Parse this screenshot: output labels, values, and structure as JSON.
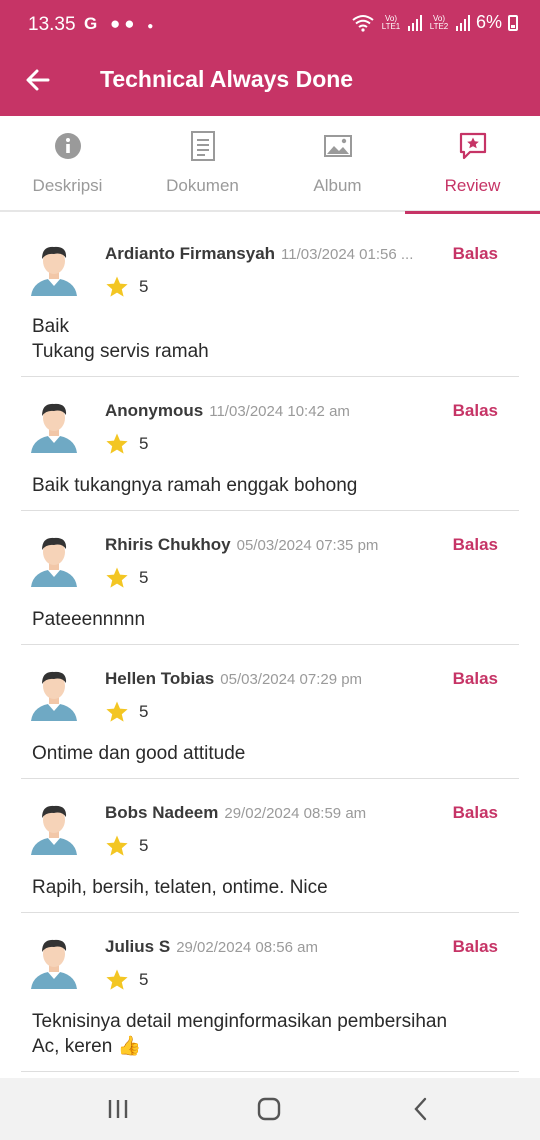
{
  "status_bar": {
    "time": "13.35",
    "notification_icons": "G",
    "battery": "6%",
    "sim1_label": "Vo) LTE1",
    "sim2_label": "Vo) LTE2"
  },
  "app_bar": {
    "title": "Technical Always Done",
    "back_icon": "arrow-left-icon"
  },
  "tabs": [
    {
      "label": "Deskripsi",
      "icon": "info-icon",
      "active": false
    },
    {
      "label": "Dokumen",
      "icon": "document-icon",
      "active": false
    },
    {
      "label": "Album",
      "icon": "image-icon",
      "active": false
    },
    {
      "label": "Review",
      "icon": "review-star-icon",
      "active": true
    }
  ],
  "reply_label": "Balas",
  "reviews": [
    {
      "name": "Ardianto Firmansyah",
      "date": "11/03/2024 01:56 ...",
      "rating": "5",
      "text": "Baik\nTukang servis ramah"
    },
    {
      "name": "Anonymous",
      "date": "11/03/2024 10:42 am",
      "rating": "5",
      "text": "Baik tukangnya ramah enggak bohong"
    },
    {
      "name": "Rhiris Chukhoy",
      "date": "05/03/2024 07:35 pm",
      "rating": "5",
      "text": "Pateeennnnn"
    },
    {
      "name": "Hellen Tobias",
      "date": "05/03/2024 07:29 pm",
      "rating": "5",
      "text": "Ontime dan good attitude"
    },
    {
      "name": "Bobs Nadeem",
      "date": "29/02/2024 08:59 am",
      "rating": "5",
      "text": "Rapih, bersih, telaten, ontime. Nice"
    },
    {
      "name": "Julius S",
      "date": "29/02/2024 08:56 am",
      "rating": "5",
      "text": "Teknisinya detail menginformasikan pembersihan\nAc, keren 👍"
    }
  ],
  "colors": {
    "primary": "#c63466",
    "star": "#f3c623",
    "muted": "#9a9a9a"
  },
  "nav_bar": {
    "recents_icon": "recents-icon",
    "home_icon": "home-icon",
    "back_icon": "back-chevron-icon"
  }
}
